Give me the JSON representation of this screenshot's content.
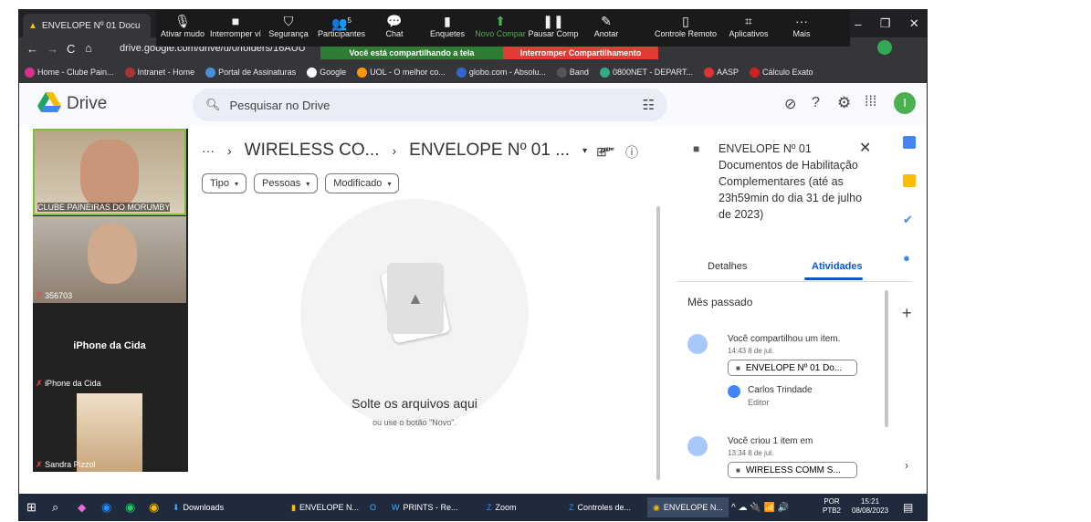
{
  "browser": {
    "tab_title": "ENVELOPE Nº 01 Docu",
    "url": "drive.google.com/drive/u/0/folders/16AUU"
  },
  "zoom": {
    "buttons": [
      {
        "label": "Ativar mudo",
        "icon": "🎙"
      },
      {
        "label": "Interromper ví",
        "icon": "■"
      },
      {
        "label": "Segurança",
        "icon": "⛉"
      },
      {
        "label": "Participantes",
        "icon": "👥",
        "badge": "5"
      },
      {
        "label": "Chat",
        "icon": "💬"
      },
      {
        "label": "Enquetes",
        "icon": "▮"
      },
      {
        "label": "Novo Compar",
        "icon": "↑"
      },
      {
        "label": "Pausar Comp",
        "icon": "❚❚"
      },
      {
        "label": "Anotar",
        "icon": "✎"
      },
      {
        "label": "Controle Remoto",
        "icon": "▯"
      },
      {
        "label": "Aplicativos",
        "icon": "⌗"
      },
      {
        "label": "Mais",
        "icon": "···"
      }
    ],
    "sharing_text": "Você está compartilhando a tela",
    "stop_text": "Interromper Compartilhamento"
  },
  "bookmarks": [
    "Home - Clube Pain...",
    "Intranet - Home",
    "Portal de Assinaturas",
    "Google",
    "UOL - O melhor co...",
    "globo.com - Absolu...",
    "Band",
    "0800NET - DEPART...",
    "AASP",
    "Cálculo Exato"
  ],
  "drive": {
    "logo": "Drive",
    "search_placeholder": "Pesquisar no Drive",
    "user_initial": "I"
  },
  "videos": [
    {
      "name": "CLUBE PAINEIRAS DO MORUMBY"
    },
    {
      "name": "356703"
    },
    {
      "name": "iPhone da Cida",
      "center": "iPhone da Cida"
    },
    {
      "name": "Sandra Pizzol"
    }
  ],
  "breadcrumb": {
    "ellipsis": "···",
    "parent": "WIRELESS CO...",
    "current": "ENVELOPE Nº 01 ..."
  },
  "filters": [
    "Tipo",
    "Pessoas",
    "Modificado"
  ],
  "drop": {
    "title": "Solte os arquivos aqui",
    "sub": "ou use o botão \"Novo\"."
  },
  "panel": {
    "title": "ENVELOPE Nº 01 Documentos de Habilitação Complementares (até as 23h59min do dia 31 de julho de 2023)",
    "tabs": [
      "Detalhes",
      "Atividades"
    ],
    "section": "Mês passado",
    "activities": [
      {
        "text": "Você compartilhou um item.",
        "time": "14:43 8 de jul.",
        "item": "ENVELOPE Nº 01 Do...",
        "person": "Carlos Trindade",
        "role": "Editor"
      },
      {
        "text": "Você criou 1 item em",
        "time": "13:34 8 de jul.",
        "item": "WIRELESS COMM S..."
      }
    ]
  },
  "taskbar": {
    "items": [
      "Downloads",
      "ENVELOPE N...",
      "PRINTS - Re...",
      "Zoom",
      "Controles de...",
      "ENVELOPE N..."
    ],
    "lang": "POR",
    "layout": "PTB2",
    "time": "15:21",
    "date": "08/08/2023"
  }
}
